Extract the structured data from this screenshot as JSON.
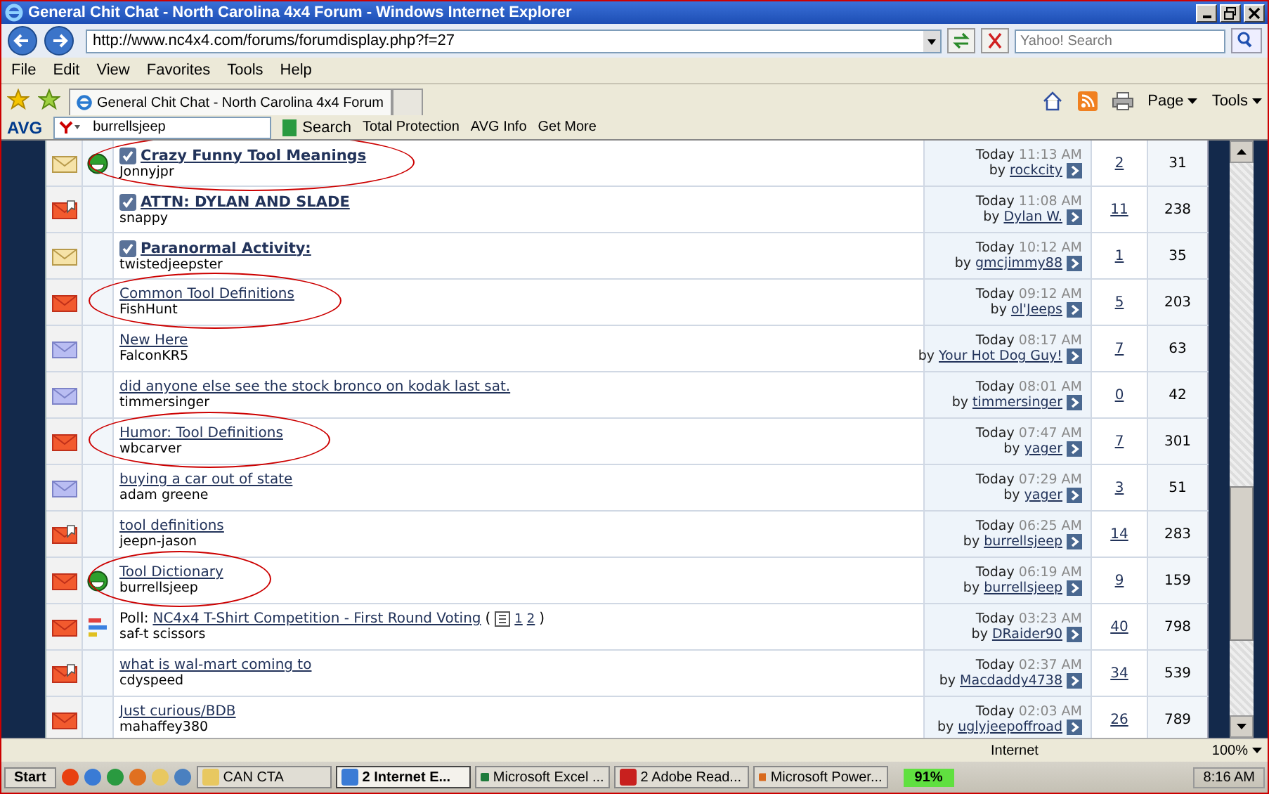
{
  "window": {
    "title": "General Chit Chat - North Carolina 4x4 Forum - Windows Internet Explorer"
  },
  "address_bar": {
    "url": "http://www.nc4x4.com/forums/forumdisplay.php?f=27",
    "search_placeholder": "Yahoo! Search"
  },
  "menu": [
    "File",
    "Edit",
    "View",
    "Favorites",
    "Tools",
    "Help"
  ],
  "tabs": [
    {
      "label": "General Chit Chat - North Carolina 4x4 Forum",
      "selected": true
    }
  ],
  "command_bar": [
    "Page",
    "Tools"
  ],
  "avg_toolbar": {
    "brand": "AVG",
    "search_value": "burrellsjeep",
    "search_button": "Search",
    "items": [
      "Total Protection",
      "AVG Info",
      "Get More"
    ]
  },
  "threads": [
    {
      "kind": "pale",
      "posted": false,
      "icon": {
        "kind": "grin"
      },
      "sticky": true,
      "circled": true,
      "title": "Crazy Funny Tool Meanings",
      "author": "Jonnyjpr",
      "day": "Today",
      "time": "11:13 AM",
      "by": "by",
      "last_poster": "rockcity",
      "replies": "2",
      "views": "31"
    },
    {
      "kind": "red",
      "posted": true,
      "sticky": true,
      "circled": false,
      "title": "ATTN: DYLAN AND SLADE",
      "author": "snappy",
      "day": "Today",
      "time": "11:08 AM",
      "by": "by",
      "last_poster": "Dylan W.",
      "replies": "11",
      "views": "238"
    },
    {
      "kind": "pale",
      "posted": false,
      "sticky": true,
      "circled": false,
      "title": "Paranormal Activity:",
      "author": "twistedjeepster",
      "day": "Today",
      "time": "10:12 AM",
      "by": "by",
      "last_poster": "gmcjimmy88",
      "replies": "1",
      "views": "35"
    },
    {
      "kind": "red",
      "posted": false,
      "sticky": false,
      "circled": true,
      "title": "Common Tool Definitions",
      "author": "FishHunt",
      "day": "Today",
      "time": "09:12 AM",
      "by": "by",
      "last_poster": "ol'Jeeps",
      "replies": "5",
      "views": "203"
    },
    {
      "kind": "lavender",
      "posted": false,
      "sticky": false,
      "circled": false,
      "title": "New Here",
      "author": "FalconKR5",
      "day": "Today",
      "time": "08:17 AM",
      "by": "by",
      "last_poster": "Your Hot Dog Guy!",
      "replies": "7",
      "views": "63"
    },
    {
      "kind": "lavender",
      "posted": false,
      "sticky": false,
      "circled": false,
      "title": "did anyone else see the stock bronco on kodak last sat.",
      "author": "timmersinger",
      "day": "Today",
      "time": "08:01 AM",
      "by": "by",
      "last_poster": "timmersinger",
      "replies": "0",
      "views": "42"
    },
    {
      "kind": "red",
      "posted": false,
      "sticky": false,
      "circled": true,
      "title": "Humor: Tool Definitions",
      "author": "wbcarver",
      "day": "Today",
      "time": "07:47 AM",
      "by": "by",
      "last_poster": "yager",
      "replies": "7",
      "views": "301"
    },
    {
      "kind": "lavender",
      "posted": false,
      "sticky": false,
      "circled": false,
      "title": "buying a car out of state",
      "author": "adam greene",
      "day": "Today",
      "time": "07:29 AM",
      "by": "by",
      "last_poster": "yager",
      "replies": "3",
      "views": "51"
    },
    {
      "kind": "red",
      "posted": true,
      "sticky": false,
      "circled": false,
      "title": "tool definitions",
      "author": "jeepn-jason",
      "day": "Today",
      "time": "06:25 AM",
      "by": "by",
      "last_poster": "burrellsjeep",
      "replies": "14",
      "views": "283"
    },
    {
      "kind": "red",
      "posted": false,
      "icon": {
        "kind": "grin"
      },
      "sticky": false,
      "circled": true,
      "title": "Tool Dictionary",
      "author": "burrellsjeep",
      "day": "Today",
      "time": "06:19 AM",
      "by": "by",
      "last_poster": "burrellsjeep",
      "replies": "9",
      "views": "159"
    },
    {
      "kind": "red",
      "posted": false,
      "icon": {
        "kind": "poll"
      },
      "sticky": false,
      "circled": false,
      "prefix": "Poll:",
      "title": "NC4x4 T-Shirt Competition - First Round Voting",
      "page_open": "(",
      "pages": [
        "1",
        "2"
      ],
      "page_close": ")",
      "author": "saf-t scissors",
      "day": "Today",
      "time": "03:23 AM",
      "by": "by",
      "last_poster": "DRaider90",
      "replies": "40",
      "views": "798"
    },
    {
      "kind": "red",
      "posted": true,
      "sticky": false,
      "circled": false,
      "title": "what is wal-mart coming to",
      "author": "cdyspeed",
      "day": "Today",
      "time": "02:37 AM",
      "by": "by",
      "last_poster": "Macdaddy4738",
      "replies": "34",
      "views": "539"
    },
    {
      "kind": "red",
      "posted": false,
      "sticky": false,
      "circled": false,
      "title": "Just curious/BDB",
      "author": "mahaffey380",
      "day": "Today",
      "time": "02:03 AM",
      "by": "by",
      "last_poster": "uglyjeepoffroad",
      "replies": "26",
      "views": "789"
    }
  ],
  "status_bar": {
    "zone": "Internet",
    "zoom": "100%"
  },
  "taskbar": {
    "start": "Start",
    "tasks": [
      {
        "label": "CAN CTA",
        "kind": "folder",
        "selected": false
      },
      {
        "label": "2 Internet E...",
        "kind": "ie",
        "selected": true
      },
      {
        "label": "Microsoft Excel ...",
        "kind": "excel",
        "selected": false
      },
      {
        "label": "2 Adobe Read...",
        "kind": "adobe",
        "selected": false
      },
      {
        "label": "Microsoft Power...",
        "kind": "powerpoint",
        "selected": false
      }
    ],
    "battery": "91%",
    "clock": "8:16 AM"
  }
}
